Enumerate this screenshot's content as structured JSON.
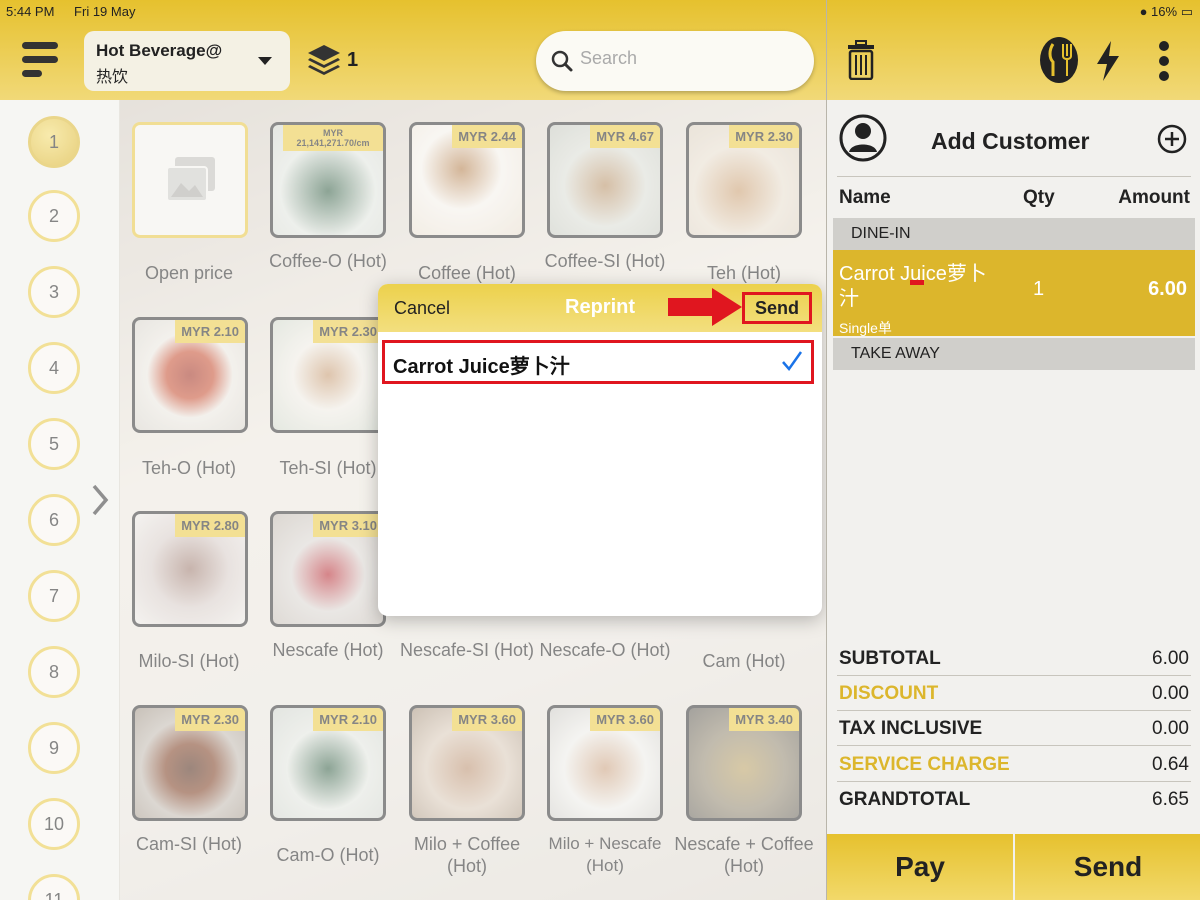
{
  "status": {
    "time": "5:44 PM",
    "date": "Fri 19 May",
    "battery": "16%"
  },
  "header": {
    "category_line1": "Hot Beverage@",
    "category_line2": "热饮",
    "layers_count": "1",
    "search_placeholder": "Search"
  },
  "tables": [
    "1",
    "2",
    "3",
    "4",
    "5",
    "6",
    "7",
    "8",
    "9",
    "10",
    "11"
  ],
  "active_table": "1",
  "items": [
    {
      "name": "Open price",
      "price": ""
    },
    {
      "name": "Coffee-O (Hot)",
      "price": "MYR 21,141,271.70/cm"
    },
    {
      "name": "Coffee (Hot)",
      "price": "MYR 2.44"
    },
    {
      "name": "Coffee-SI (Hot)",
      "price": "MYR 4.67"
    },
    {
      "name": "Teh (Hot)",
      "price": "MYR 2.30"
    },
    {
      "name": "Teh-O (Hot)",
      "price": "MYR 2.10"
    },
    {
      "name": "Teh-SI (Hot)",
      "price": "MYR 2.30"
    },
    {
      "name": "Milo-SI (Hot)",
      "price": "MYR 2.80"
    },
    {
      "name": "Nescafe (Hot)",
      "price": "MYR 3.10"
    },
    {
      "name": "Nescafe-SI (Hot)",
      "price": ""
    },
    {
      "name": "Nescafe-O (Hot)",
      "price": ""
    },
    {
      "name": "Cam (Hot)",
      "price": ""
    },
    {
      "name": "Cam-SI (Hot)",
      "price": "MYR 2.30"
    },
    {
      "name": "Cam-O (Hot)",
      "price": "MYR 2.10"
    },
    {
      "name": "Milo + Coffee (Hot)",
      "price": "MYR 3.60"
    },
    {
      "name": "Milo + Nescafe (Hot)",
      "price": "MYR 3.60"
    },
    {
      "name": "Nescafe + Coffee (Hot)",
      "price": "MYR 3.40"
    }
  ],
  "modal": {
    "cancel_label": "Cancel",
    "title": "Reprint",
    "send_label": "Send",
    "row_label": "Carrot Juice萝卜汁"
  },
  "order": {
    "add_customer": "Add Customer",
    "col_name": "Name",
    "col_qty": "Qty",
    "col_amount": "Amount",
    "section_dine_in": "DINE-IN",
    "section_take_away": "TAKE AWAY",
    "line_name": "Carrot Juice萝卜汁",
    "line_qty": "1",
    "line_amount": "6.00",
    "line_sub": "Single单"
  },
  "totals": {
    "subtotal_label": "SUBTOTAL",
    "subtotal": "6.00",
    "discount_label": "DISCOUNT",
    "discount": "0.00",
    "tax_label": "TAX INCLUSIVE",
    "tax": "0.00",
    "service_label": "SERVICE CHARGE",
    "service": "0.64",
    "grand_label": "GRANDTOTAL",
    "grand": "6.65"
  },
  "actions": {
    "pay_label": "Pay",
    "send_label": "Send"
  },
  "colors": {
    "accent": "#e6c12e",
    "gold_text": "#dcb62c",
    "highlight_red": "#e0161f",
    "check_blue": "#1a73e8"
  }
}
